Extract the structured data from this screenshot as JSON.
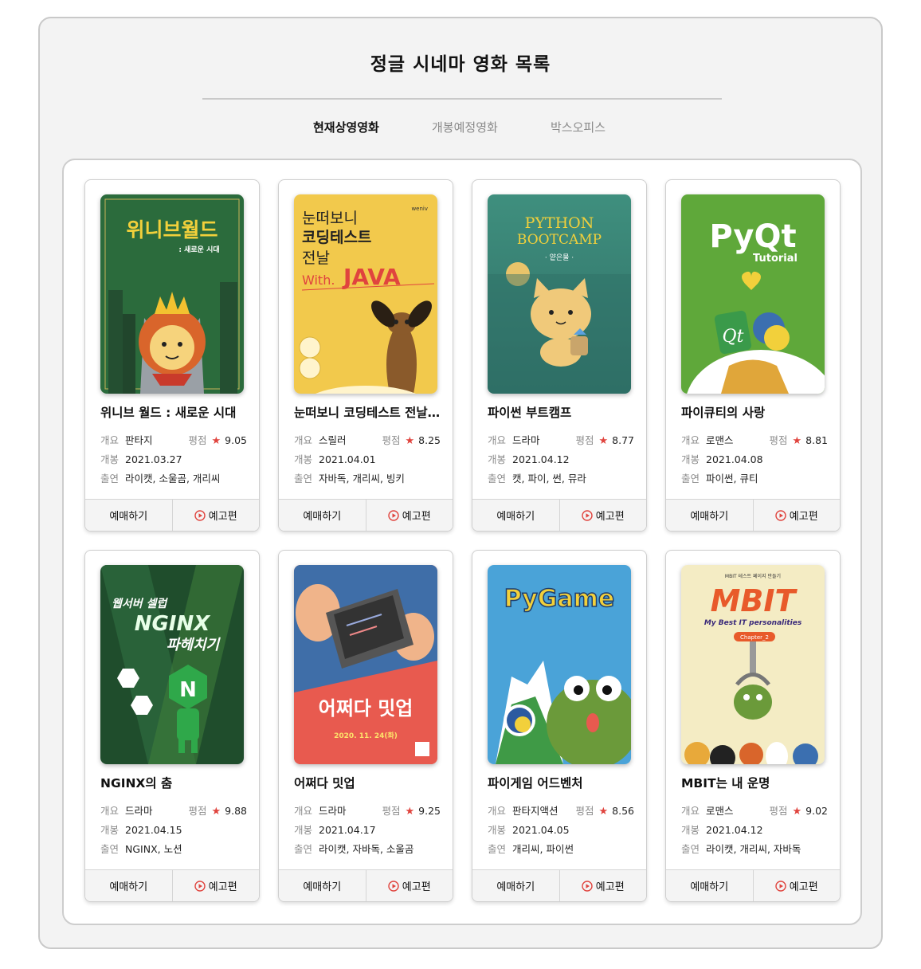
{
  "page_title": "정글 시네마 영화 목록",
  "tabs": [
    {
      "label": "현재상영영화",
      "active": true
    },
    {
      "label": "개봉예정영화",
      "active": false
    },
    {
      "label": "박스오피스",
      "active": false
    }
  ],
  "labels": {
    "overview": "개요",
    "rating": "평점",
    "release": "개봉",
    "cast": "출연",
    "book": "예매하기",
    "trailer": "예고편",
    "star": "★"
  },
  "colors": {
    "star": "#e0443e",
    "play": "#e0443e"
  },
  "movies": [
    {
      "title": "위니브 월드 : 새로운 시대",
      "genre": "판타지",
      "rating": "9.05",
      "release": "2021.03.27",
      "cast": "라이캣, 소울곰, 개리씨",
      "poster": {
        "bg": "#2b6b3c",
        "icon": "lion-king-icon",
        "lines": [
          "위니브월드",
          ": 새로운 시대"
        ]
      }
    },
    {
      "title": "눈떠보니 코딩테스트 전날 With. JAVA",
      "genre": "스릴러",
      "rating": "8.25",
      "release": "2021.04.01",
      "cast": "자바독, 개리씨, 빙키",
      "poster": {
        "bg": "#f2c94c",
        "icon": "dog-icon",
        "brand": "weniv",
        "lines": [
          "눈떠보니",
          "코딩테스트",
          "전날",
          "With.",
          "JAVA"
        ]
      }
    },
    {
      "title": "파이썬 부트캠프",
      "genre": "드라마",
      "rating": "8.77",
      "release": "2021.04.12",
      "cast": "캣, 파이, 썬, 뮤라",
      "poster": {
        "bg": "#3a8a7b",
        "icon": "cat-icon",
        "lines": [
          "PYTHON",
          "BOOTCAMP",
          "· 얕은물 ·"
        ]
      }
    },
    {
      "title": "파이큐티의 사랑",
      "genre": "로맨스",
      "rating": "8.81",
      "release": "2021.04.08",
      "cast": "파이썬, 큐티",
      "poster": {
        "bg": "#5fa83a",
        "icon": "qt-python-icon",
        "lines": [
          "PyQt",
          "Tutorial",
          "Qt"
        ]
      }
    },
    {
      "title": "NGINX의 춤",
      "genre": "드라마",
      "rating": "9.88",
      "release": "2021.04.15",
      "cast": "NGINX, 노션",
      "poster": {
        "bg": "#1f4d2c",
        "icon": "nginx-icon",
        "lines": [
          "웹서버 셀럽",
          "NGINX",
          "파헤치기",
          "N"
        ]
      }
    },
    {
      "title": "어쩌다 밋업",
      "genre": "드라마",
      "rating": "9.25",
      "release": "2021.04.17",
      "cast": "라이캣, 자바독, 소울곰",
      "poster": {
        "bg": "#e85a4f",
        "icon": "laptop-icon",
        "lines": [
          "어쩌다 밋업",
          "2020. 11. 24(화)"
        ]
      }
    },
    {
      "title": "파이게임 어드벤처",
      "genre": "판타지액션",
      "rating": "8.56",
      "release": "2021.04.05",
      "cast": "개리씨, 파이썬",
      "poster": {
        "bg": "#4aa3d8",
        "icon": "frog-icon",
        "lines": [
          "PyGame"
        ]
      }
    },
    {
      "title": "MBIT는 내 운명",
      "genre": "로맨스",
      "rating": "9.02",
      "release": "2021.04.12",
      "cast": "라이캣, 개리씨, 자바독",
      "poster": {
        "bg": "#f4ecc4",
        "icon": "claw-machine-icon",
        "lines": [
          "MBIT 테스트 페이지 만들기",
          "MBIT",
          "My Best IT personalities",
          "Chapter_2"
        ]
      }
    }
  ]
}
